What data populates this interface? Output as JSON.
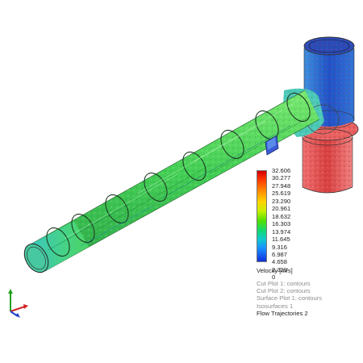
{
  "legend": {
    "values": [
      "32.606",
      "30.277",
      "27.948",
      "25.619",
      "23.290",
      "20.961",
      "18.632",
      "16.303",
      "13.974",
      "11.645",
      "9.316",
      "6.987",
      "4.658",
      "2.329",
      "0"
    ],
    "unit_label": "Velocity [m/s]"
  },
  "plots": [
    {
      "label": "Cut Plot 1: contours",
      "active": false
    },
    {
      "label": "Cut Plot 2: contours",
      "active": false
    },
    {
      "label": "Surface Plot 1: contours",
      "active": false
    },
    {
      "label": "Isosurfaces 1",
      "active": false
    },
    {
      "label": "Flow Trajectories 2",
      "active": true
    }
  ],
  "colors": {
    "pipe_main": "#52d860",
    "pipe_inlet": "#2cc6c8",
    "pipe_dark": "#2f9a3c",
    "vessel_top": "#2a5fd0",
    "vessel_bottom": "#e84848",
    "axis_x": "#d02020",
    "axis_y": "#20a020",
    "axis_z": "#2040d0"
  }
}
